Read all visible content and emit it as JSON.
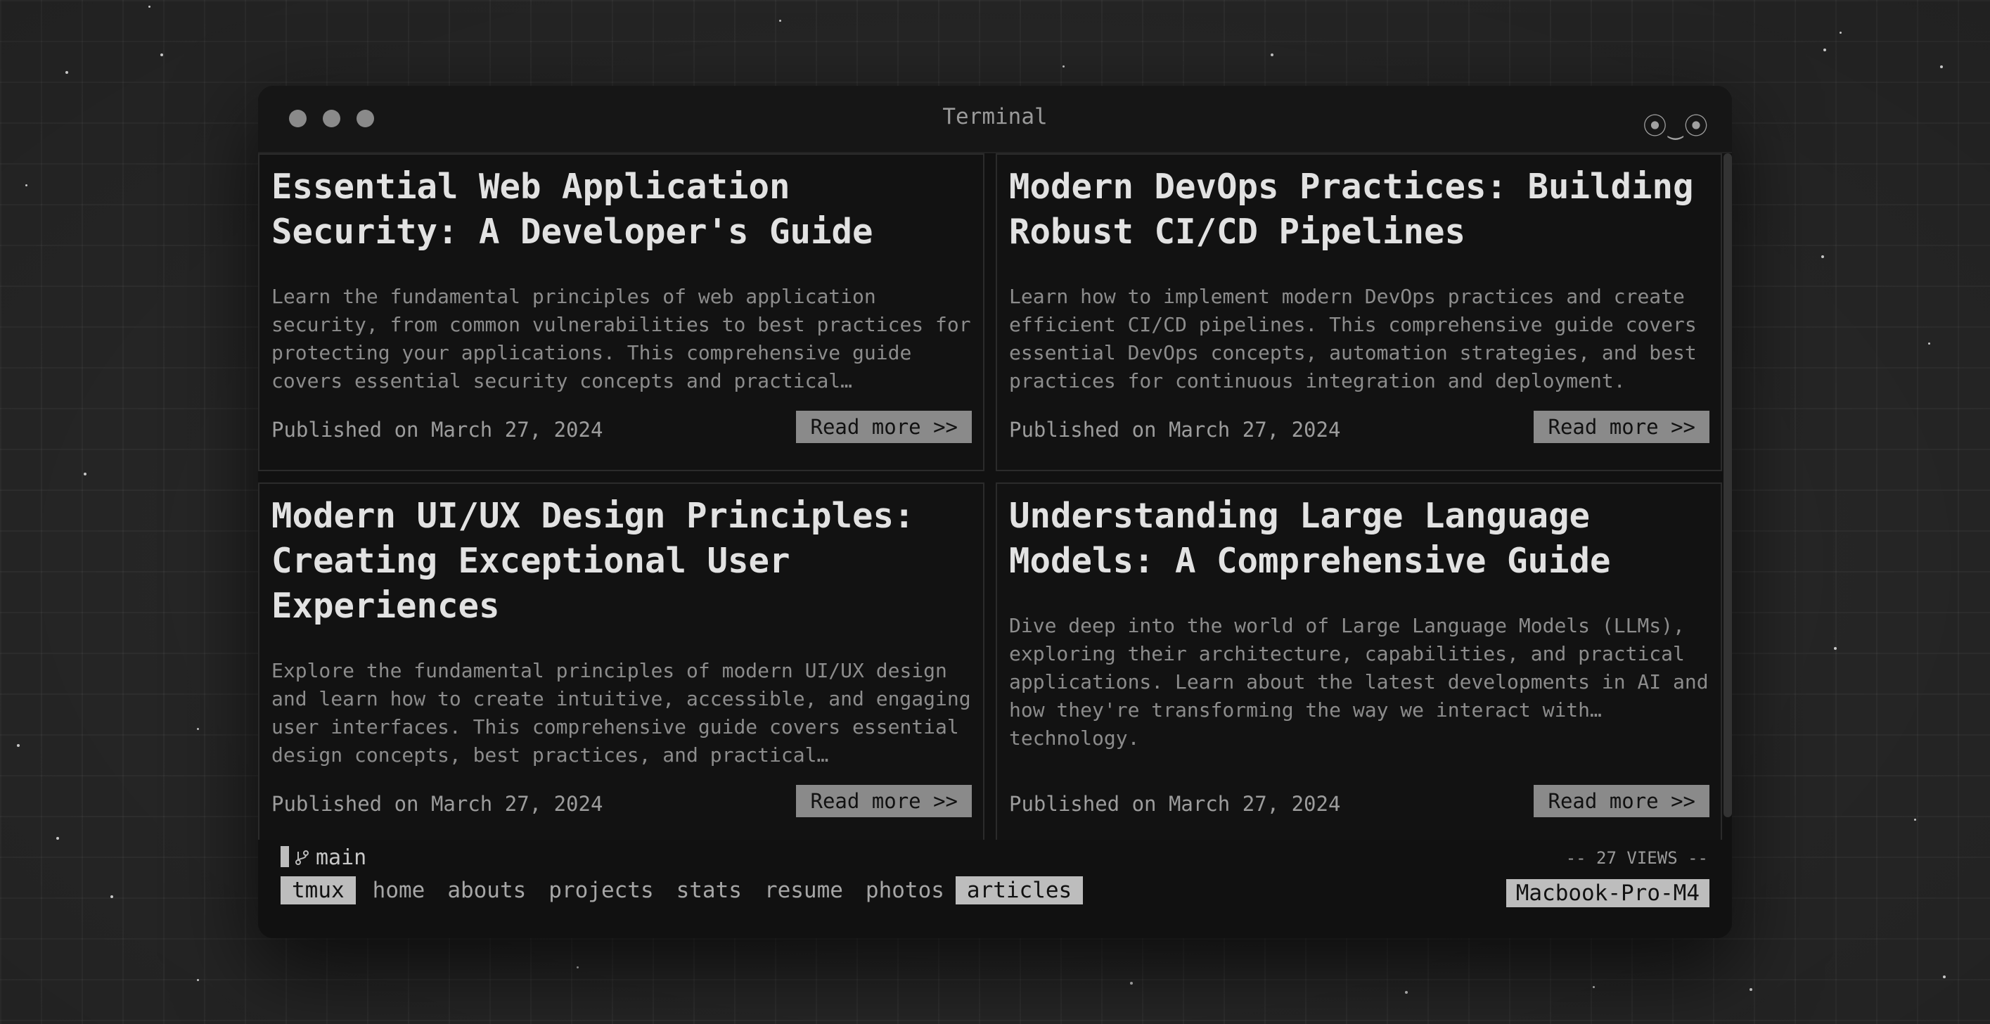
{
  "window": {
    "title": "Terminal",
    "face": "⦿‿⦿"
  },
  "articles": [
    {
      "title": "Essential Web Application Security: A Developer's Guide",
      "excerpt": "Learn the fundamental principles of web application security, from common vulnerabilities to best practices for protecting your applications. This comprehensive guide covers essential security concepts and practical…",
      "published": "Published on March 27, 2024",
      "cta": "Read more >>"
    },
    {
      "title": "Modern DevOps Practices: Building Robust CI/CD Pipelines",
      "excerpt": "Learn how to implement modern DevOps practices and create efficient CI/CD pipelines. This comprehensive guide covers essential DevOps concepts, automation strategies, and best practices for continuous integration and deployment.",
      "published": "Published on March 27, 2024",
      "cta": "Read more >>"
    },
    {
      "title": "Modern UI/UX Design Principles: Creating Exceptional User Experiences",
      "excerpt": "Explore the fundamental principles of modern UI/UX design and learn how to create intuitive, accessible, and engaging user interfaces. This comprehensive guide covers essential design concepts, best practices, and practical…",
      "published": "Published on March 27, 2024",
      "cta": "Read more >>"
    },
    {
      "title": "Understanding Large Language Models: A Comprehensive Guide",
      "excerpt": "Dive deep into the world of Large Language Models (LLMs), exploring their architecture, capabilities, and practical applications. Learn about the latest developments in AI and how they're transforming the way we interact with… technology.",
      "published": "Published on March 27, 2024",
      "cta": "Read more >>"
    }
  ],
  "statusbar": {
    "branch_icon": "git-branch-icon",
    "branch": "main",
    "views": "-- 27 VIEWS --",
    "session": "tmux",
    "nav": [
      "home",
      "abouts",
      "projects",
      "stats",
      "resume",
      "photos",
      "articles"
    ],
    "active_nav": "articles",
    "host": "Macbook-Pro-M4"
  }
}
